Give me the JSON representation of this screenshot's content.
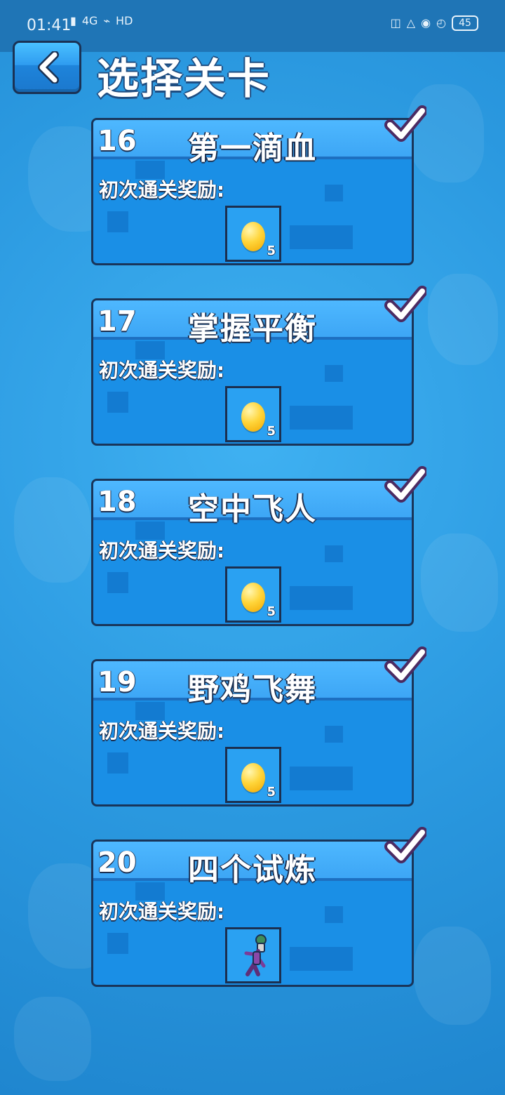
{
  "status_bar": {
    "time": "01:41",
    "network_label": "4G",
    "hd_label": "HD",
    "battery": "45",
    "icons": [
      "signal-icon",
      "wifi-icon",
      "hd-icon",
      "gamepad-icon",
      "bell-off-icon",
      "lock-icon",
      "alarm-icon",
      "battery-icon"
    ]
  },
  "header": {
    "title": "选择关卡",
    "back_icon": "chevron-left-icon"
  },
  "levels": [
    {
      "number": "16",
      "name": "第一滴血",
      "reward_label": "初次通关奖励:",
      "reward_type": "coin",
      "reward_count": "5",
      "completed": true
    },
    {
      "number": "17",
      "name": "掌握平衡",
      "reward_label": "初次通关奖励:",
      "reward_type": "coin",
      "reward_count": "5",
      "completed": true
    },
    {
      "number": "18",
      "name": "空中飞人",
      "reward_label": "初次通关奖励:",
      "reward_type": "coin",
      "reward_count": "5",
      "completed": true
    },
    {
      "number": "19",
      "name": "野鸡飞舞",
      "reward_label": "初次通关奖励:",
      "reward_type": "coin",
      "reward_count": "5",
      "completed": true
    },
    {
      "number": "20",
      "name": "四个试炼",
      "reward_label": "初次通关奖励:",
      "reward_type": "character",
      "reward_count": "",
      "completed": true
    }
  ],
  "colors": {
    "background": "#2a98df",
    "card": "#1a8fe6",
    "header": "#4eb8ff",
    "outline": "#19355a"
  }
}
